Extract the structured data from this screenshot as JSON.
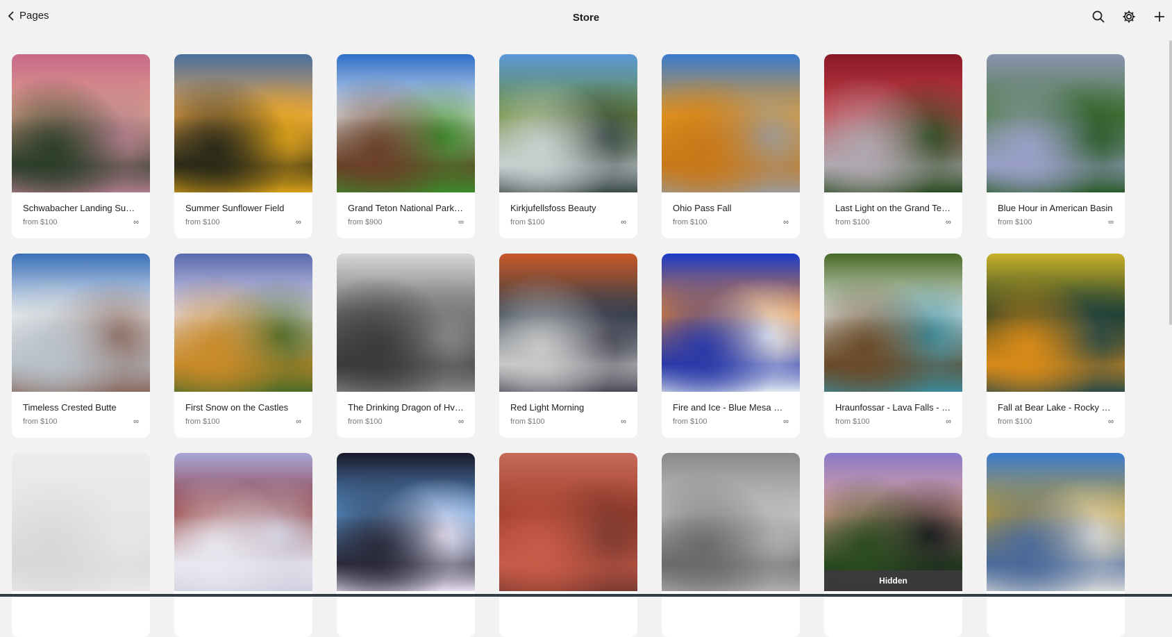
{
  "header": {
    "back_label": "Pages",
    "title": "Store"
  },
  "icons": {
    "back": "chevron-left-icon",
    "search": "search-icon",
    "settings": "gear-icon",
    "add": "plus-icon"
  },
  "products": [
    {
      "name": "Schwabacher Landing Sunr...",
      "price": "from $100",
      "stock": "∞",
      "colors": [
        "#c86a8a",
        "#e0a48c",
        "#2c3e2a",
        "#b07c8c"
      ]
    },
    {
      "name": "Summer Sunflower Field",
      "price": "from $100",
      "stock": "∞",
      "colors": [
        "#4a6fa0",
        "#f0a84a",
        "#2a2a18",
        "#d9a018"
      ]
    },
    {
      "name": "Grand Teton National Park ...",
      "price": "from $900",
      "stock": "∞",
      "colors": [
        "#2f6fc8",
        "#e8ecf0",
        "#6a4028",
        "#3a8a2a"
      ]
    },
    {
      "name": "Kirkjufellsfoss Beauty",
      "price": "from $100",
      "stock": "∞",
      "colors": [
        "#5a9ad8",
        "#6a8a30",
        "#c8d0d0",
        "#3a4848"
      ]
    },
    {
      "name": "Ohio Pass Fall",
      "price": "from $100",
      "stock": "∞",
      "colors": [
        "#3a7ad0",
        "#e89a20",
        "#c87818",
        "#9a9a9a"
      ]
    },
    {
      "name": "Last Light on the Grand Teton",
      "price": "from $100",
      "stock": "∞",
      "colors": [
        "#8a1a28",
        "#c84048",
        "#b0a8b0",
        "#2a4a20"
      ]
    },
    {
      "name": "Blue Hour in American Basin",
      "price": "from $100",
      "stock": "∞",
      "colors": [
        "#8a94b0",
        "#4a7a3a",
        "#9aa0c8",
        "#2a5a28"
      ]
    },
    {
      "name": "Timeless Crested Butte",
      "price": "from $100",
      "stock": "∞",
      "colors": [
        "#3a70b8",
        "#f2f4f6",
        "#b8c0c8",
        "#8a6a60"
      ]
    },
    {
      "name": "First Snow on the Castles",
      "price": "from $100",
      "stock": "∞",
      "colors": [
        "#5a6ab0",
        "#e8e0f0",
        "#c88a28",
        "#4a6a28"
      ]
    },
    {
      "name": "The Drinking Dragon of Hvít...",
      "price": "from $100",
      "stock": "∞",
      "colors": [
        "#d8d8d8",
        "#6a6a6a",
        "#3a3a3a",
        "#8a8a8a"
      ]
    },
    {
      "name": "Red Light Morning",
      "price": "from $100",
      "stock": "∞",
      "colors": [
        "#c85a28",
        "#2a3a48",
        "#c8c8c8",
        "#4a4a58"
      ]
    },
    {
      "name": "Fire and Ice - Blue Mesa Re...",
      "price": "from $100",
      "stock": "∞",
      "colors": [
        "#1a3ac8",
        "#f08a28",
        "#2a3aa8",
        "#e0e8f0"
      ]
    },
    {
      "name": "Hraunfossar - Lava Falls - Ic...",
      "price": "from $100",
      "stock": "∞",
      "colors": [
        "#4a6a28",
        "#e8f0f0",
        "#6a4a28",
        "#3a8a9a"
      ]
    },
    {
      "name": "Fall at Bear Lake - Rocky M...",
      "price": "from $100",
      "stock": "∞",
      "colors": [
        "#c8b028",
        "#1a3a28",
        "#d88a18",
        "#2a4a48"
      ]
    },
    {
      "name": "",
      "price": "",
      "stock": "",
      "colors": [
        "#ececec",
        "#e6e6e6",
        "#d8d8d8",
        "#e8e8e8"
      ]
    },
    {
      "name": "",
      "price": "",
      "stock": "",
      "colors": [
        "#a8a8d8",
        "#8a2a28",
        "#e8e8f0",
        "#d0d0e0"
      ]
    },
    {
      "name": "",
      "price": "",
      "stock": "",
      "colors": [
        "#1a1a2a",
        "#5a9ad8",
        "#2a2a3a",
        "#e8e0f0"
      ]
    },
    {
      "name": "",
      "price": "",
      "stock": "",
      "colors": [
        "#c86a5a",
        "#9a3a28",
        "#c85a48",
        "#7a3a30"
      ]
    },
    {
      "name": "",
      "price": "",
      "stock": "",
      "colors": [
        "#8a8a8a",
        "#c8c8c8",
        "#6a6a6a",
        "#b0b0b0"
      ]
    },
    {
      "name": "",
      "price": "",
      "stock": "",
      "colors": [
        "#8a7ac8",
        "#e8a898",
        "#2a4a20",
        "#1a1a20"
      ],
      "overlay": "Hidden"
    },
    {
      "name": "",
      "price": "",
      "stock": "",
      "colors": [
        "#3a7ad0",
        "#c8a028",
        "#4a6a9a",
        "#d8d8d8"
      ]
    }
  ]
}
